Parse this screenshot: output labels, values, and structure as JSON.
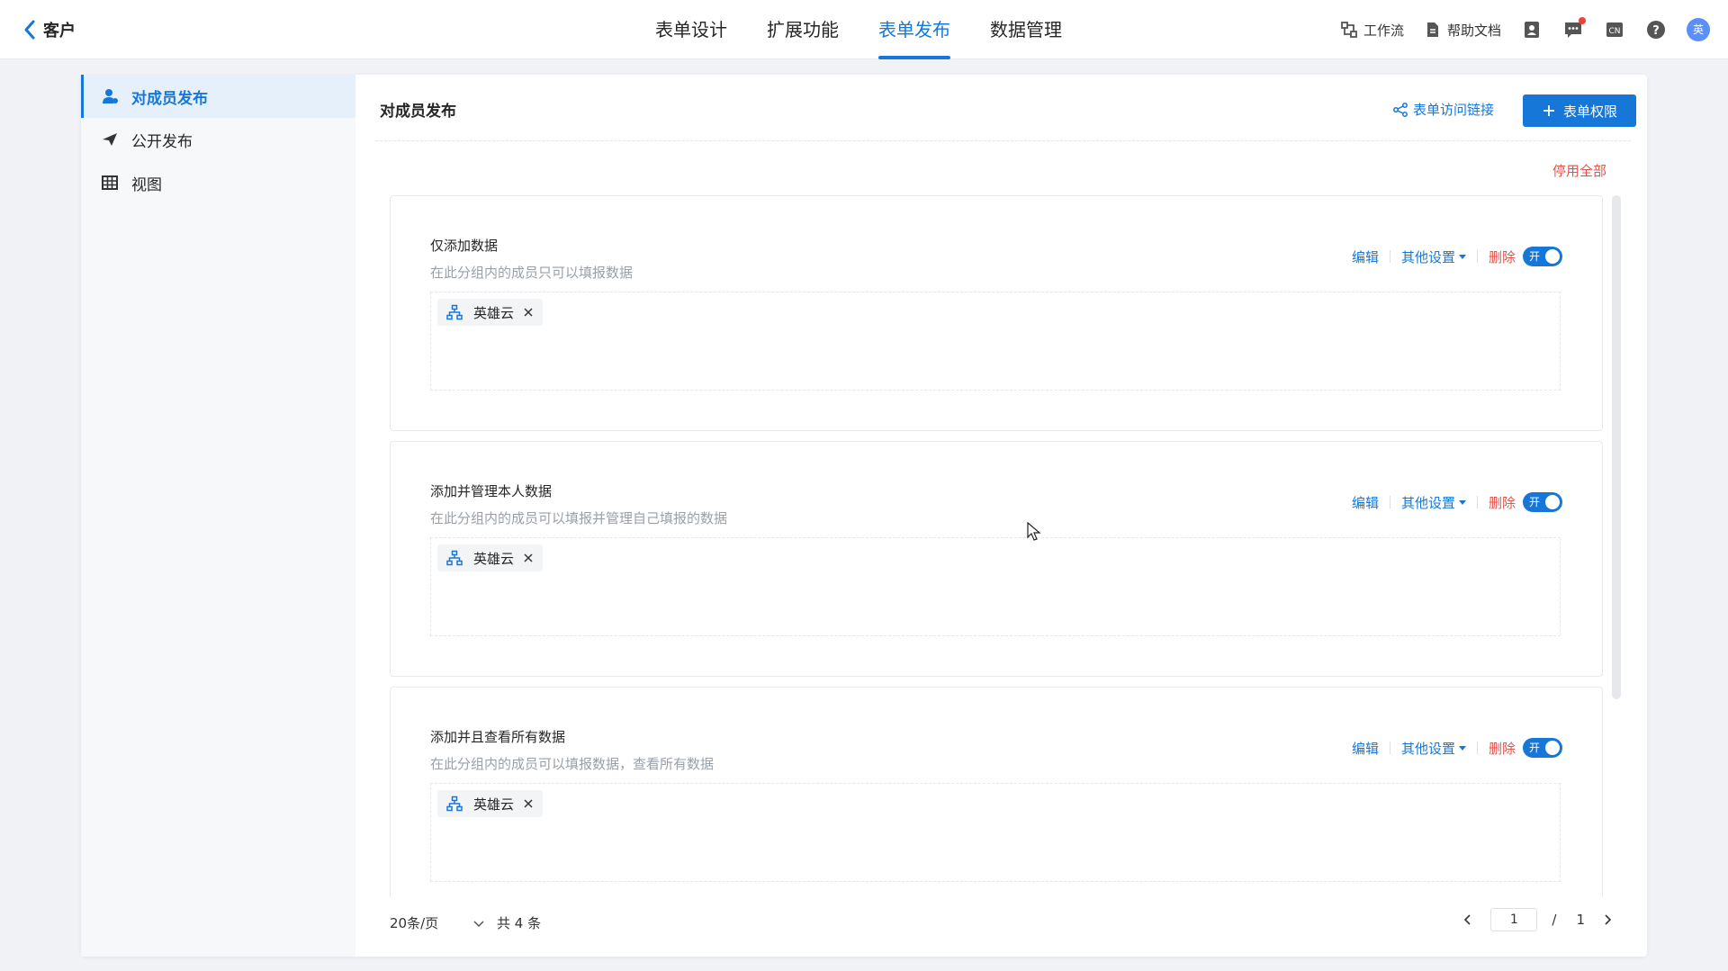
{
  "header": {
    "back_label": "客户",
    "tabs": [
      {
        "label": "表单设计",
        "active": false
      },
      {
        "label": "扩展功能",
        "active": false
      },
      {
        "label": "表单发布",
        "active": true
      },
      {
        "label": "数据管理",
        "active": false
      }
    ],
    "tools": {
      "workflow": "工作流",
      "help_docs": "帮助文档",
      "lang": "CN",
      "avatar_text": "英"
    }
  },
  "sidebar": {
    "items": [
      {
        "label": "对成员发布",
        "icon": "member-icon",
        "active": true
      },
      {
        "label": "公开发布",
        "icon": "paper-plane-icon",
        "active": false
      },
      {
        "label": "视图",
        "icon": "table-icon",
        "active": false
      }
    ]
  },
  "main": {
    "title": "对成员发布",
    "access_link": "表单访问链接",
    "add_permission": "表单权限",
    "disable_all": "停用全部",
    "cards": [
      {
        "title": "仅添加数据",
        "desc": "在此分组内的成员只可以填报数据",
        "member": "英雄云",
        "toggle": "开"
      },
      {
        "title": "添加并管理本人数据",
        "desc": "在此分组内的成员可以填报并管理自己填报的数据",
        "member": "英雄云",
        "toggle": "开"
      },
      {
        "title": "添加并且查看所有数据",
        "desc": "在此分组内的成员可以填报数据，查看所有数据",
        "member": "英雄云",
        "toggle": "开"
      }
    ],
    "actions": {
      "edit": "编辑",
      "other": "其他设置",
      "delete": "删除"
    },
    "footer": {
      "page_size": "20条/页",
      "total": "共 4 条",
      "current_page": "1",
      "slash": "/",
      "total_pages": "1"
    }
  },
  "colors": {
    "accent": "#1677d9",
    "danger": "#e0534a"
  }
}
